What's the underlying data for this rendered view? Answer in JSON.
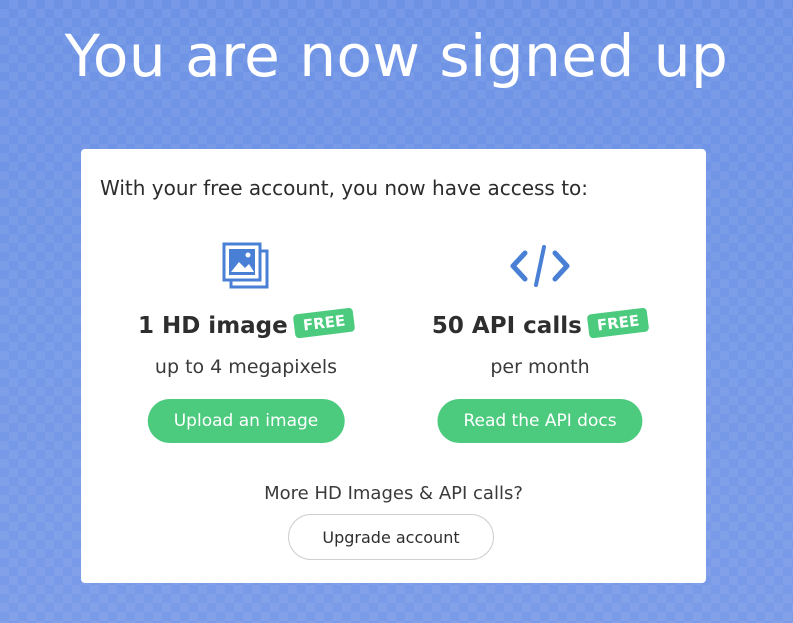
{
  "page": {
    "title": "You are now signed up"
  },
  "card": {
    "intro": "With your free account, you now have access to:",
    "features": [
      {
        "icon": "images-icon",
        "title": "1 HD image",
        "badge": "FREE",
        "subtitle": "up to 4 megapixels",
        "button_label": "Upload an image"
      },
      {
        "icon": "code-icon",
        "title": "50 API calls",
        "badge": "FREE",
        "subtitle": "per month",
        "button_label": "Read the API docs"
      }
    ],
    "more_text": "More HD Images & API calls?",
    "upgrade_label": "Upgrade account"
  },
  "colors": {
    "background": "#6f95e6",
    "accent_green": "#4ccb7f",
    "icon_blue": "#4a7fd6"
  }
}
